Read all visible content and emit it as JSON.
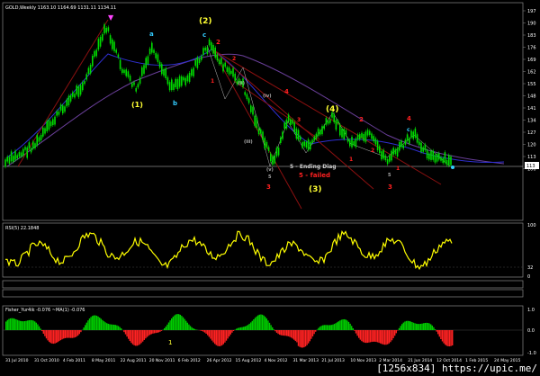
{
  "header": {
    "symbol_info": "GOLD,Weekly  1163.10 1164.69 1131.11 1134.11"
  },
  "price_axis": {
    "ticks": [
      "197",
      "190",
      "183",
      "176",
      "169",
      "162",
      "155",
      "148",
      "141",
      "134",
      "127",
      "120",
      "113",
      "106"
    ],
    "current_price": "113"
  },
  "rsi_panel": {
    "label": "RSI(5) 22.1848",
    "ticks": [
      "100",
      "32",
      "0"
    ]
  },
  "fisher_panel": {
    "label": "Fisher_Yur4ik -0.076  ~MA(1) -0.076",
    "ticks": [
      "1.0",
      "0.0",
      "-1.0"
    ]
  },
  "date_axis": {
    "labels": [
      "31 Jul 2010",
      "31 Oct 2010",
      "4 Feb 2011",
      "8 May 2011",
      "22 Aug 2011",
      "20 Nov 2011",
      "6 Feb 2012",
      "26 Apr 2012",
      "15 Aug 2012",
      "4 Nov 2012",
      "31 Mar 2013",
      "21 Jul 2013",
      "10 Nov 2013",
      "2 Mar 2014",
      "21 Jun 2014",
      "12 Oct 2014",
      "1 Feb 2015",
      "24 May 2015"
    ]
  },
  "wave_labels": {
    "w1": "(1)",
    "w2": "(2)",
    "w3": "(3)",
    "w4": "(4)",
    "a1": "a",
    "b1": "b",
    "c1": "c",
    "r2a": "2",
    "r1": "1",
    "r2b": "2",
    "r3": "3",
    "r4a": "4",
    "r2c": "2",
    "r1b": "1",
    "r4b": "4",
    "r2d": "2",
    "r3b": "3",
    "r1c": "1",
    "r3c": "3",
    "rc": "c",
    "ii": "(ii)",
    "iv": "(iv)",
    "iii": "(iii)",
    "v": "(v)",
    "ending_diag": "5 - Ending Diag",
    "failed": "5 - failed",
    "five_a": "5",
    "five_b": "5",
    "fisher_mark": "1"
  },
  "watermark": "[1256x834]  https://upic.me/",
  "colors": {
    "background": "#000000",
    "candle": "#00ff00",
    "rsi": "#ffff00",
    "fisher_pos": "#00cc00",
    "fisher_neg": "#ff2222",
    "wave_red": "#ff2020",
    "wave_yellow": "#ffff33",
    "wave_cyan": "#33ccff",
    "trendline_red": "#b01010"
  }
}
